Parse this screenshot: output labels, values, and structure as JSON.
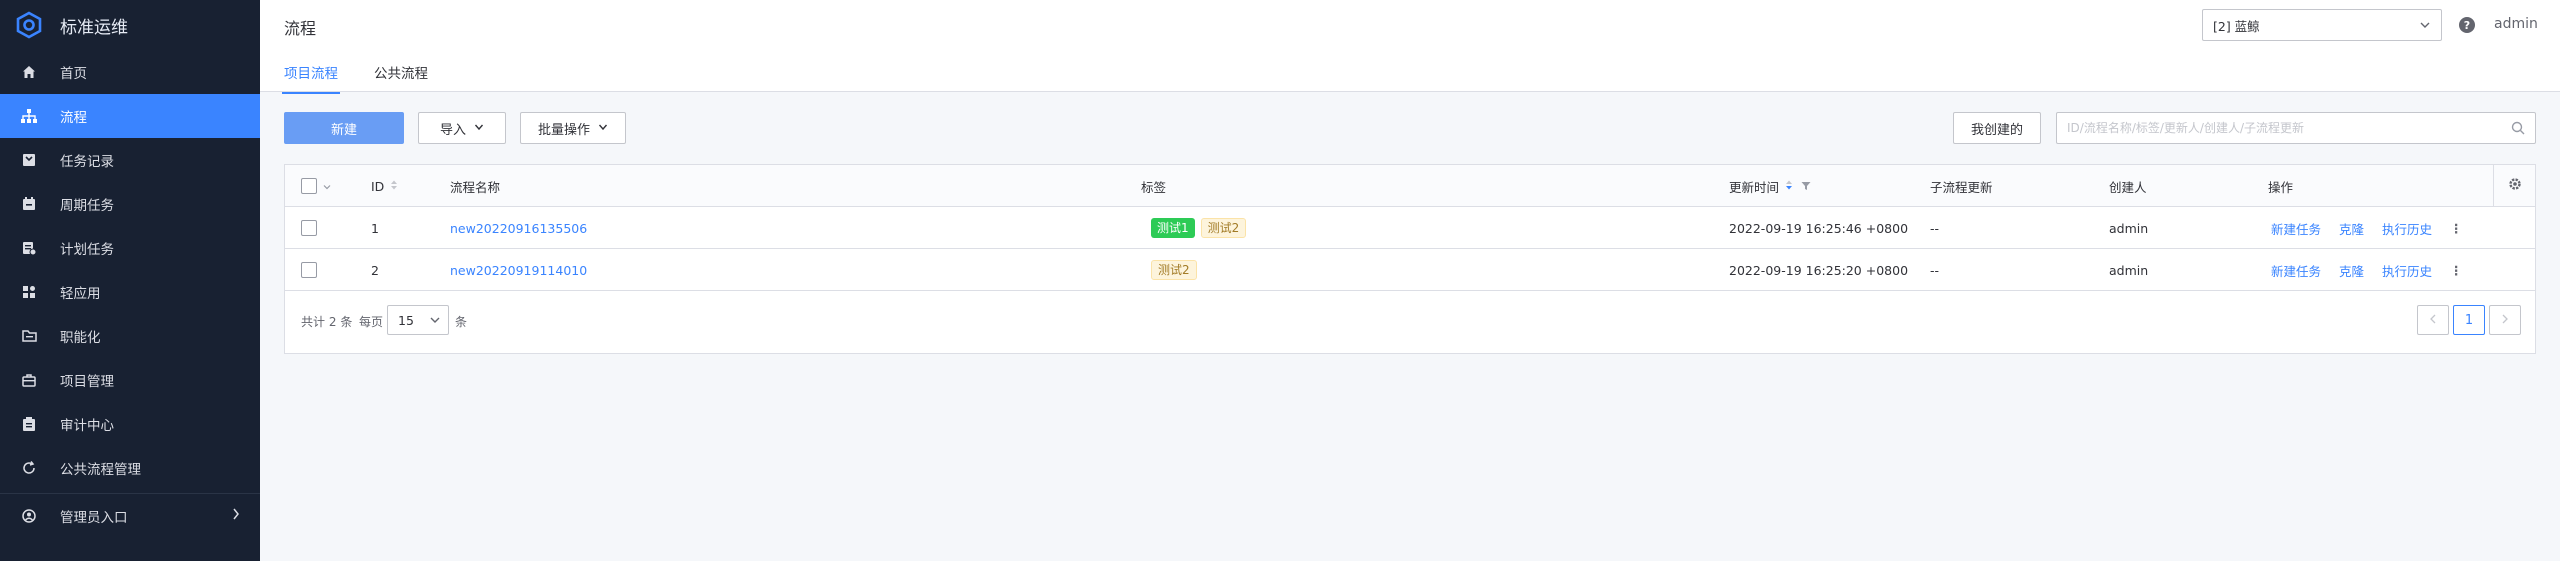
{
  "brand": {
    "name": "标准运维"
  },
  "sidebar": {
    "items": [
      {
        "label": "首页",
        "icon": "home-icon"
      },
      {
        "label": "流程",
        "icon": "flow-icon",
        "active": true
      },
      {
        "label": "任务记录",
        "icon": "task-record-icon"
      },
      {
        "label": "周期任务",
        "icon": "calendar-icon"
      },
      {
        "label": "计划任务",
        "icon": "plan-icon"
      },
      {
        "label": "轻应用",
        "icon": "apps-icon"
      },
      {
        "label": "职能化",
        "icon": "function-icon"
      },
      {
        "label": "项目管理",
        "icon": "project-icon"
      },
      {
        "label": "审计中心",
        "icon": "audit-icon"
      },
      {
        "label": "公共流程管理",
        "icon": "refresh-icon"
      }
    ],
    "admin_entry": {
      "label": "管理员入口",
      "icon": "admin-icon"
    }
  },
  "header": {
    "title": "流程",
    "tabs": [
      {
        "label": "项目流程",
        "active": true
      },
      {
        "label": "公共流程",
        "active": false
      }
    ],
    "project_select": "[2] 蓝鲸",
    "help_icon": "?",
    "user": "admin"
  },
  "toolbar": {
    "new_label": "新建",
    "import_label": "导入",
    "batch_label": "批量操作",
    "mine_label": "我创建的",
    "search_placeholder": "ID/流程名称/标签/更新人/创建人/子流程更新"
  },
  "table": {
    "columns": {
      "id": "ID",
      "name": "流程名称",
      "tags": "标签",
      "updated": "更新时间",
      "subflow": "子流程更新",
      "creator": "创建人",
      "ops": "操作"
    },
    "rows": [
      {
        "id": "1",
        "name": "new20220916135506",
        "tags": [
          {
            "text": "测试1",
            "color": "green"
          },
          {
            "text": "测试2",
            "color": "yellow"
          }
        ],
        "updated": "2022-09-19 16:25:46 +0800",
        "subflow": "--",
        "creator": "admin",
        "ops": [
          "新建任务",
          "克隆",
          "执行历史"
        ]
      },
      {
        "id": "2",
        "name": "new20220919114010",
        "tags": [
          {
            "text": "测试2",
            "color": "yellow"
          }
        ],
        "updated": "2022-09-19 16:25:20 +0800",
        "subflow": "--",
        "creator": "admin",
        "ops": [
          "新建任务",
          "克隆",
          "执行历史"
        ]
      }
    ]
  },
  "pagination": {
    "total_prefix": "共计",
    "total": "2",
    "total_suffix": "条",
    "per_page_label": "每页",
    "page_size": "15",
    "unit": "条",
    "current_page": "1"
  },
  "colors": {
    "accent": "#3a84ff",
    "sidebar_bg": "#182132",
    "tag_green": "#2dcb56",
    "tag_yellow_bg": "#fdf4dc"
  }
}
